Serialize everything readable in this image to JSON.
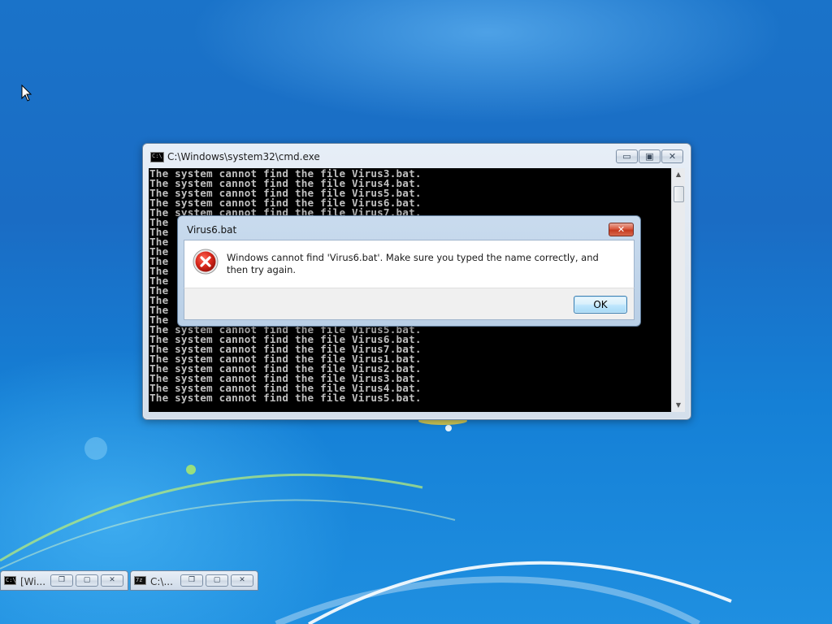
{
  "cmd_window": {
    "title": "C:\\Windows\\system32\\cmd.exe",
    "minimize_glyph": "▭",
    "maximize_glyph": "▣",
    "close_glyph": "✕",
    "console_lines": [
      "The system cannot find the file Virus3.bat.",
      "The system cannot find the file Virus4.bat.",
      "The system cannot find the file Virus5.bat.",
      "The system cannot find the file Virus6.bat.",
      "The system cannot find the file Virus7.bat.",
      "The",
      "The",
      "The",
      "The",
      "The",
      "The",
      "The",
      "The",
      "The",
      "The",
      "The",
      "The system cannot find the file Virus5.bat.",
      "The system cannot find the file Virus6.bat.",
      "The system cannot find the file Virus7.bat.",
      "The system cannot find the file Virus1.bat.",
      "The system cannot find the file Virus2.bat.",
      "The system cannot find the file Virus3.bat.",
      "The system cannot find the file Virus4.bat.",
      "The system cannot find the file Virus5.bat."
    ]
  },
  "dialog": {
    "title": "Virus6.bat",
    "close_glyph": "✕",
    "message": "Windows cannot find 'Virus6.bat'. Make sure you typed the name correctly, and then try again.",
    "ok_label": "OK",
    "icon": "error-icon"
  },
  "minimized": [
    {
      "label": "[Wi...",
      "icon": "cmd-icon"
    },
    {
      "label": "C:\\...",
      "icon": "7zip-icon"
    }
  ],
  "colors": {
    "desktop": "#1a6cc4",
    "console_bg": "#000000",
    "console_text": "#c0c0c0",
    "close_red": "#c53a20"
  }
}
